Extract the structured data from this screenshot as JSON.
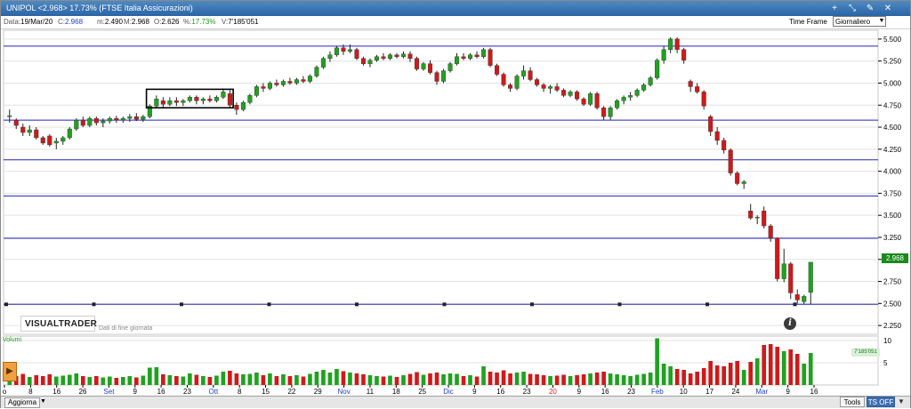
{
  "window": {
    "title": "UNIPOL <2.968> 17.73%  (FTSE Italia Assicurazioni)",
    "buttons": [
      "+",
      "⤡",
      "✎",
      "✕"
    ]
  },
  "infobar": {
    "data_label": "Data:",
    "data_value": "19/Mar/20",
    "close_label": "C:",
    "close_value": "2.968",
    "min_label": "m:",
    "min_value": "2.490",
    "max_label": "M:",
    "max_value": "2.968",
    "open_label": "O:",
    "open_value": "2.626",
    "pct_label": "%:",
    "pct_value": "17.73%",
    "vol_label": "V:",
    "vol_value": "7'185'051",
    "timeframe_label": "Time Frame",
    "timeframe_value": "Giornaliero"
  },
  "logo": "VISUALTRADER",
  "eod_note": "Dati di fine giornata",
  "volume_label": "Volumi",
  "volume_info": "7'185'051",
  "last_price_tag": "2.968",
  "bottom": {
    "aggiorna": "Aggiorna",
    "tools": "Tools",
    "ts_off": "TS OFF"
  },
  "colors": {
    "up": "#1fa21f",
    "down": "#d01919",
    "hline": "#2323c8",
    "grid": "#e2e2e2",
    "title_bar": "#3a74b4"
  },
  "chart_data": {
    "type": "candlestick",
    "title": "UNIPOL <2.968> 17.73%  (FTSE Italia Assicurazioni)",
    "price_axis_ticks": [
      "5.500",
      "5.250",
      "5.000",
      "4.750",
      "4.500",
      "4.250",
      "4.000",
      "3.750",
      "3.500",
      "3.250",
      "3.000",
      "2.750",
      "2.500",
      "2.250"
    ],
    "ylim": [
      2.15,
      5.6
    ],
    "volume_axis_ticks": [
      "10",
      "5"
    ],
    "volume_ylim": [
      0,
      11
    ],
    "date_ticks": [
      "o",
      "8",
      "16",
      "26",
      "Set",
      "9",
      "16",
      "23",
      "Ott",
      "8",
      "15",
      "22",
      "29",
      "Nov",
      "11",
      "18",
      "25",
      "Dic",
      "9",
      "16",
      "23",
      "20",
      "9",
      "16",
      "23",
      "Feb",
      "10",
      "17",
      "24",
      "Mar",
      "9",
      "16"
    ],
    "red_date_tick": "20",
    "blue_date_ticks": [
      "Set",
      "Ott",
      "Nov",
      "Dic",
      "Feb",
      "Mar"
    ],
    "horizontal_levels": [
      5.42,
      4.58,
      4.13,
      3.72,
      3.24,
      2.49
    ],
    "grid": true,
    "candles": [
      {
        "o": 4.62,
        "h": 4.7,
        "l": 4.55,
        "c": 4.63,
        "v": 2.2
      },
      {
        "o": 4.58,
        "h": 4.6,
        "l": 4.48,
        "c": 4.52,
        "v": 2.0
      },
      {
        "o": 4.5,
        "h": 4.54,
        "l": 4.4,
        "c": 4.44,
        "v": 2.5
      },
      {
        "o": 4.44,
        "h": 4.52,
        "l": 4.4,
        "c": 4.47,
        "v": 1.8
      },
      {
        "o": 4.47,
        "h": 4.5,
        "l": 4.36,
        "c": 4.38,
        "v": 2.2
      },
      {
        "o": 4.38,
        "h": 4.4,
        "l": 4.3,
        "c": 4.32,
        "v": 2.0
      },
      {
        "o": 4.4,
        "h": 4.42,
        "l": 4.28,
        "c": 4.3,
        "v": 2.4
      },
      {
        "o": 4.32,
        "h": 4.38,
        "l": 4.25,
        "c": 4.34,
        "v": 1.9
      },
      {
        "o": 4.34,
        "h": 4.4,
        "l": 4.3,
        "c": 4.38,
        "v": 2.1
      },
      {
        "o": 4.38,
        "h": 4.5,
        "l": 4.36,
        "c": 4.48,
        "v": 2.3
      },
      {
        "o": 4.48,
        "h": 4.6,
        "l": 4.46,
        "c": 4.58,
        "v": 2.6
      },
      {
        "o": 4.58,
        "h": 4.62,
        "l": 4.5,
        "c": 4.52,
        "v": 2.0
      },
      {
        "o": 4.52,
        "h": 4.62,
        "l": 4.5,
        "c": 4.6,
        "v": 1.8
      },
      {
        "o": 4.6,
        "h": 4.62,
        "l": 4.52,
        "c": 4.55,
        "v": 2.0
      },
      {
        "o": 4.55,
        "h": 4.6,
        "l": 4.5,
        "c": 4.57,
        "v": 1.7
      },
      {
        "o": 4.57,
        "h": 4.62,
        "l": 4.54,
        "c": 4.6,
        "v": 1.9
      },
      {
        "o": 4.6,
        "h": 4.63,
        "l": 4.55,
        "c": 4.58,
        "v": 1.6
      },
      {
        "o": 4.58,
        "h": 4.62,
        "l": 4.55,
        "c": 4.6,
        "v": 1.8
      },
      {
        "o": 4.6,
        "h": 4.65,
        "l": 4.56,
        "c": 4.62,
        "v": 2.0
      },
      {
        "o": 4.62,
        "h": 4.66,
        "l": 4.57,
        "c": 4.59,
        "v": 1.7
      },
      {
        "o": 4.59,
        "h": 4.64,
        "l": 4.56,
        "c": 4.62,
        "v": 2.1
      },
      {
        "o": 4.62,
        "h": 4.76,
        "l": 4.6,
        "c": 4.74,
        "v": 3.9
      },
      {
        "o": 4.74,
        "h": 4.86,
        "l": 4.72,
        "c": 4.82,
        "v": 4.0
      },
      {
        "o": 4.8,
        "h": 4.84,
        "l": 4.72,
        "c": 4.76,
        "v": 2.4
      },
      {
        "o": 4.76,
        "h": 4.84,
        "l": 4.74,
        "c": 4.8,
        "v": 2.2
      },
      {
        "o": 4.8,
        "h": 4.84,
        "l": 4.74,
        "c": 4.78,
        "v": 2.0
      },
      {
        "o": 4.78,
        "h": 4.82,
        "l": 4.74,
        "c": 4.8,
        "v": 1.9
      },
      {
        "o": 4.8,
        "h": 4.86,
        "l": 4.78,
        "c": 4.84,
        "v": 2.6
      },
      {
        "o": 4.84,
        "h": 4.86,
        "l": 4.76,
        "c": 4.8,
        "v": 2.3
      },
      {
        "o": 4.8,
        "h": 4.84,
        "l": 4.76,
        "c": 4.82,
        "v": 2.0
      },
      {
        "o": 4.82,
        "h": 4.86,
        "l": 4.78,
        "c": 4.8,
        "v": 1.8
      },
      {
        "o": 4.8,
        "h": 4.86,
        "l": 4.78,
        "c": 4.84,
        "v": 2.1
      },
      {
        "o": 4.84,
        "h": 4.94,
        "l": 4.82,
        "c": 4.9,
        "v": 3.0
      },
      {
        "o": 4.88,
        "h": 4.92,
        "l": 4.72,
        "c": 4.75,
        "v": 3.2
      },
      {
        "o": 4.75,
        "h": 4.78,
        "l": 4.64,
        "c": 4.7,
        "v": 2.6
      },
      {
        "o": 4.7,
        "h": 4.8,
        "l": 4.68,
        "c": 4.78,
        "v": 2.4
      },
      {
        "o": 4.78,
        "h": 4.88,
        "l": 4.76,
        "c": 4.86,
        "v": 2.5
      },
      {
        "o": 4.86,
        "h": 4.98,
        "l": 4.84,
        "c": 4.96,
        "v": 2.8
      },
      {
        "o": 4.96,
        "h": 5.0,
        "l": 4.9,
        "c": 4.94,
        "v": 2.2
      },
      {
        "o": 4.94,
        "h": 5.02,
        "l": 4.92,
        "c": 5.0,
        "v": 2.6
      },
      {
        "o": 5.0,
        "h": 5.04,
        "l": 4.96,
        "c": 4.98,
        "v": 2.0
      },
      {
        "o": 4.98,
        "h": 5.04,
        "l": 4.96,
        "c": 5.02,
        "v": 2.4
      },
      {
        "o": 5.02,
        "h": 5.06,
        "l": 4.98,
        "c": 5.0,
        "v": 2.0
      },
      {
        "o": 5.0,
        "h": 5.06,
        "l": 4.98,
        "c": 5.04,
        "v": 2.2
      },
      {
        "o": 5.04,
        "h": 5.08,
        "l": 5.0,
        "c": 5.02,
        "v": 1.9
      },
      {
        "o": 5.02,
        "h": 5.1,
        "l": 5.0,
        "c": 5.08,
        "v": 2.5
      },
      {
        "o": 5.08,
        "h": 5.2,
        "l": 5.06,
        "c": 5.18,
        "v": 3.0
      },
      {
        "o": 5.18,
        "h": 5.3,
        "l": 5.16,
        "c": 5.28,
        "v": 3.4
      },
      {
        "o": 5.28,
        "h": 5.36,
        "l": 5.24,
        "c": 5.32,
        "v": 2.8
      },
      {
        "o": 5.32,
        "h": 5.42,
        "l": 5.3,
        "c": 5.4,
        "v": 3.6
      },
      {
        "o": 5.4,
        "h": 5.44,
        "l": 5.32,
        "c": 5.36,
        "v": 3.1
      },
      {
        "o": 5.36,
        "h": 5.44,
        "l": 5.34,
        "c": 5.38,
        "v": 2.8
      },
      {
        "o": 5.38,
        "h": 5.4,
        "l": 5.26,
        "c": 5.28,
        "v": 2.6
      },
      {
        "o": 5.28,
        "h": 5.3,
        "l": 5.2,
        "c": 5.22,
        "v": 2.4
      },
      {
        "o": 5.22,
        "h": 5.28,
        "l": 5.18,
        "c": 5.26,
        "v": 2.2
      },
      {
        "o": 5.26,
        "h": 5.32,
        "l": 5.24,
        "c": 5.3,
        "v": 2.0
      },
      {
        "o": 5.3,
        "h": 5.34,
        "l": 5.26,
        "c": 5.28,
        "v": 1.9
      },
      {
        "o": 5.28,
        "h": 5.34,
        "l": 5.26,
        "c": 5.32,
        "v": 2.1
      },
      {
        "o": 5.32,
        "h": 5.34,
        "l": 5.28,
        "c": 5.3,
        "v": 1.8
      },
      {
        "o": 5.3,
        "h": 5.36,
        "l": 5.28,
        "c": 5.33,
        "v": 2.2
      },
      {
        "o": 5.33,
        "h": 5.36,
        "l": 5.24,
        "c": 5.28,
        "v": 2.5
      },
      {
        "o": 5.28,
        "h": 5.3,
        "l": 5.14,
        "c": 5.16,
        "v": 2.9
      },
      {
        "o": 5.16,
        "h": 5.24,
        "l": 5.14,
        "c": 5.22,
        "v": 2.3
      },
      {
        "o": 5.22,
        "h": 5.26,
        "l": 5.1,
        "c": 5.12,
        "v": 2.6
      },
      {
        "o": 5.12,
        "h": 5.14,
        "l": 4.98,
        "c": 5.02,
        "v": 2.8
      },
      {
        "o": 5.02,
        "h": 5.16,
        "l": 5.0,
        "c": 5.14,
        "v": 2.4
      },
      {
        "o": 5.14,
        "h": 5.24,
        "l": 5.12,
        "c": 5.22,
        "v": 2.6
      },
      {
        "o": 5.22,
        "h": 5.34,
        "l": 5.2,
        "c": 5.3,
        "v": 2.5
      },
      {
        "o": 5.3,
        "h": 5.34,
        "l": 5.26,
        "c": 5.28,
        "v": 2.0
      },
      {
        "o": 5.28,
        "h": 5.34,
        "l": 5.26,
        "c": 5.32,
        "v": 2.2
      },
      {
        "o": 5.32,
        "h": 5.36,
        "l": 5.28,
        "c": 5.3,
        "v": 1.9
      },
      {
        "o": 5.3,
        "h": 5.4,
        "l": 5.28,
        "c": 5.38,
        "v": 4.2
      },
      {
        "o": 5.38,
        "h": 5.4,
        "l": 5.18,
        "c": 5.2,
        "v": 3.0
      },
      {
        "o": 5.2,
        "h": 5.22,
        "l": 5.08,
        "c": 5.1,
        "v": 2.8
      },
      {
        "o": 5.1,
        "h": 5.12,
        "l": 4.96,
        "c": 4.98,
        "v": 3.3
      },
      {
        "o": 4.98,
        "h": 5.0,
        "l": 4.9,
        "c": 4.94,
        "v": 2.6
      },
      {
        "o": 4.94,
        "h": 5.1,
        "l": 4.92,
        "c": 5.08,
        "v": 2.8
      },
      {
        "o": 5.08,
        "h": 5.2,
        "l": 5.04,
        "c": 5.14,
        "v": 3.0
      },
      {
        "o": 5.14,
        "h": 5.18,
        "l": 5.02,
        "c": 5.04,
        "v": 2.5
      },
      {
        "o": 5.04,
        "h": 5.06,
        "l": 4.96,
        "c": 4.98,
        "v": 2.4
      },
      {
        "o": 4.98,
        "h": 5.0,
        "l": 4.9,
        "c": 4.94,
        "v": 2.2
      },
      {
        "o": 4.94,
        "h": 4.98,
        "l": 4.88,
        "c": 4.96,
        "v": 2.0
      },
      {
        "o": 4.96,
        "h": 5.0,
        "l": 4.9,
        "c": 4.92,
        "v": 2.1
      },
      {
        "o": 4.92,
        "h": 4.94,
        "l": 4.84,
        "c": 4.86,
        "v": 2.3
      },
      {
        "o": 4.86,
        "h": 4.92,
        "l": 4.84,
        "c": 4.9,
        "v": 2.0
      },
      {
        "o": 4.9,
        "h": 4.92,
        "l": 4.8,
        "c": 4.82,
        "v": 2.2
      },
      {
        "o": 4.82,
        "h": 4.84,
        "l": 4.74,
        "c": 4.76,
        "v": 2.4
      },
      {
        "o": 4.76,
        "h": 4.9,
        "l": 4.74,
        "c": 4.88,
        "v": 2.6
      },
      {
        "o": 4.88,
        "h": 4.9,
        "l": 4.7,
        "c": 4.72,
        "v": 2.8
      },
      {
        "o": 4.72,
        "h": 4.74,
        "l": 4.58,
        "c": 4.62,
        "v": 3.0
      },
      {
        "o": 4.62,
        "h": 4.74,
        "l": 4.58,
        "c": 4.72,
        "v": 2.6
      },
      {
        "o": 4.72,
        "h": 4.82,
        "l": 4.7,
        "c": 4.8,
        "v": 2.4
      },
      {
        "o": 4.8,
        "h": 4.86,
        "l": 4.76,
        "c": 4.84,
        "v": 2.2
      },
      {
        "o": 4.84,
        "h": 4.9,
        "l": 4.8,
        "c": 4.86,
        "v": 2.0
      },
      {
        "o": 4.86,
        "h": 4.94,
        "l": 4.84,
        "c": 4.92,
        "v": 2.3
      },
      {
        "o": 4.92,
        "h": 5.0,
        "l": 4.9,
        "c": 4.98,
        "v": 2.5
      },
      {
        "o": 4.98,
        "h": 5.08,
        "l": 4.96,
        "c": 5.06,
        "v": 2.8
      },
      {
        "o": 5.06,
        "h": 5.28,
        "l": 5.04,
        "c": 5.26,
        "v": 10.5
      },
      {
        "o": 5.26,
        "h": 5.42,
        "l": 5.22,
        "c": 5.38,
        "v": 4.8
      },
      {
        "o": 5.38,
        "h": 5.52,
        "l": 5.34,
        "c": 5.5,
        "v": 4.2
      },
      {
        "o": 5.5,
        "h": 5.52,
        "l": 5.34,
        "c": 5.38,
        "v": 3.6
      },
      {
        "o": 5.38,
        "h": 5.4,
        "l": 5.22,
        "c": 5.26,
        "v": 3.4
      },
      {
        "o": 5.02,
        "h": 5.04,
        "l": 4.9,
        "c": 4.96,
        "v": 2.6
      },
      {
        "o": 4.96,
        "h": 5.0,
        "l": 4.88,
        "c": 4.9,
        "v": 3.0
      },
      {
        "o": 4.9,
        "h": 4.92,
        "l": 4.7,
        "c": 4.74,
        "v": 3.8
      },
      {
        "o": 4.62,
        "h": 4.64,
        "l": 4.4,
        "c": 4.45,
        "v": 5.4
      },
      {
        "o": 4.45,
        "h": 4.5,
        "l": 4.3,
        "c": 4.35,
        "v": 4.4
      },
      {
        "o": 4.35,
        "h": 4.38,
        "l": 4.2,
        "c": 4.24,
        "v": 4.2
      },
      {
        "o": 4.24,
        "h": 4.26,
        "l": 3.95,
        "c": 3.98,
        "v": 5.0
      },
      {
        "o": 3.98,
        "h": 4.0,
        "l": 3.84,
        "c": 3.86,
        "v": 5.4
      },
      {
        "o": 3.86,
        "h": 3.9,
        "l": 3.8,
        "c": 3.88,
        "v": 3.4
      },
      {
        "o": 3.55,
        "h": 3.63,
        "l": 3.45,
        "c": 3.47,
        "v": 5.2
      },
      {
        "o": 3.47,
        "h": 3.5,
        "l": 3.4,
        "c": 3.48,
        "v": 6.0
      },
      {
        "o": 3.55,
        "h": 3.6,
        "l": 3.35,
        "c": 3.38,
        "v": 9.0
      },
      {
        "o": 3.38,
        "h": 3.4,
        "l": 3.2,
        "c": 3.24,
        "v": 9.2
      },
      {
        "o": 3.24,
        "h": 3.25,
        "l": 2.75,
        "c": 2.78,
        "v": 8.6
      },
      {
        "o": 2.78,
        "h": 3.12,
        "l": 2.74,
        "c": 2.95,
        "v": 7.6
      },
      {
        "o": 2.95,
        "h": 2.97,
        "l": 2.55,
        "c": 2.62,
        "v": 8.0
      },
      {
        "o": 2.6,
        "h": 2.66,
        "l": 2.5,
        "c": 2.54,
        "v": 7.0
      },
      {
        "o": 2.52,
        "h": 2.6,
        "l": 2.49,
        "c": 2.58,
        "v": 4.8
      },
      {
        "o": 2.626,
        "h": 2.968,
        "l": 2.49,
        "c": 2.968,
        "v": 7.2
      }
    ]
  }
}
